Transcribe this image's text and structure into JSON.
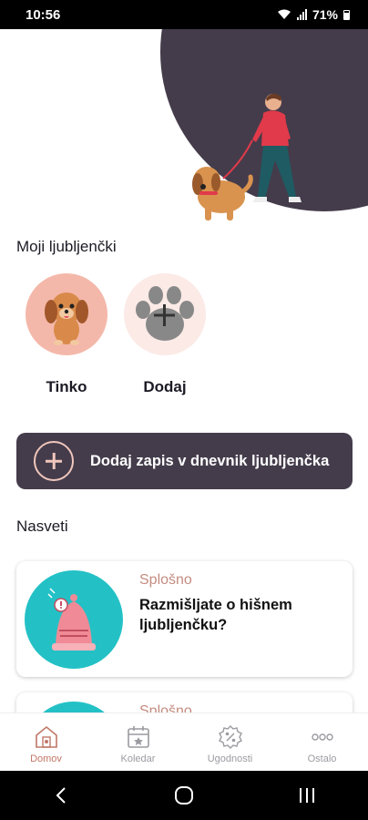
{
  "status_bar": {
    "time": "10:56",
    "battery": "71%"
  },
  "pets_section": {
    "title": "Moji ljubljenčki",
    "pets": [
      {
        "name": "Tinko"
      }
    ],
    "add_label": "Dodaj"
  },
  "add_record": {
    "label": "Dodaj zapis v dnevnik ljubljenčka"
  },
  "tips_section": {
    "title": "Nasveti",
    "cards": [
      {
        "category": "Splošno",
        "title": "Razmišljate o hišnem ljubljenčku?"
      },
      {
        "category": "Splošno",
        "title": ""
      }
    ]
  },
  "bottom_nav": {
    "items": [
      {
        "label": "Domov",
        "icon": "home-icon",
        "active": true
      },
      {
        "label": "Koledar",
        "icon": "calendar-icon",
        "active": false
      },
      {
        "label": "Ugodnosti",
        "icon": "discount-icon",
        "active": false
      },
      {
        "label": "Ostalo",
        "icon": "more-icon",
        "active": false
      }
    ]
  },
  "colors": {
    "accent_dark": "#443c4b",
    "accent_pink": "#f0c6bc",
    "tip_teal": "#23c1c6",
    "category_text": "#c48c80",
    "nav_active": "#c07868"
  }
}
